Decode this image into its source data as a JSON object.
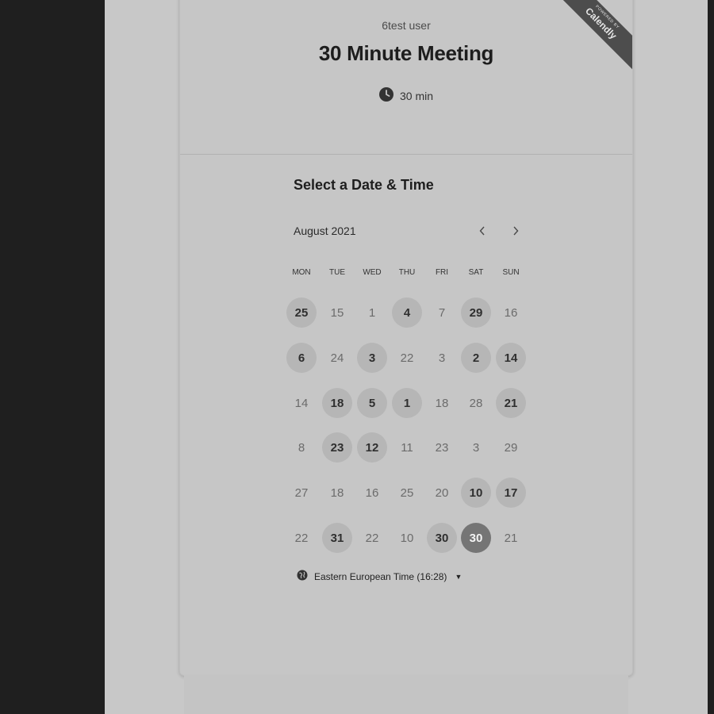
{
  "event": {
    "owner": "6test user",
    "title": "30 Minute Meeting",
    "duration": "30 min"
  },
  "ribbon": {
    "powered_by": "POWERED BY",
    "brand": "Calendly"
  },
  "booking": {
    "section_title": "Select a Date & Time",
    "month": "August 2021"
  },
  "calendar": {
    "weekdays": [
      "MON",
      "TUE",
      "WED",
      "THU",
      "FRI",
      "SAT",
      "SUN"
    ],
    "weeks": [
      [
        {
          "d": "25",
          "s": "avail"
        },
        {
          "d": "15",
          "s": "unavail"
        },
        {
          "d": "1",
          "s": "unavail"
        },
        {
          "d": "4",
          "s": "avail"
        },
        {
          "d": "7",
          "s": "unavail"
        },
        {
          "d": "29",
          "s": "avail"
        },
        {
          "d": "16",
          "s": "unavail"
        }
      ],
      [
        {
          "d": "6",
          "s": "avail"
        },
        {
          "d": "24",
          "s": "unavail"
        },
        {
          "d": "3",
          "s": "avail"
        },
        {
          "d": "22",
          "s": "unavail"
        },
        {
          "d": "3",
          "s": "unavail"
        },
        {
          "d": "2",
          "s": "avail"
        },
        {
          "d": "14",
          "s": "avail"
        }
      ],
      [
        {
          "d": "14",
          "s": "unavail"
        },
        {
          "d": "18",
          "s": "avail"
        },
        {
          "d": "5",
          "s": "avail"
        },
        {
          "d": "1",
          "s": "avail"
        },
        {
          "d": "18",
          "s": "unavail"
        },
        {
          "d": "28",
          "s": "unavail"
        },
        {
          "d": "21",
          "s": "avail"
        }
      ],
      [
        {
          "d": "8",
          "s": "unavail"
        },
        {
          "d": "23",
          "s": "avail"
        },
        {
          "d": "12",
          "s": "avail"
        },
        {
          "d": "11",
          "s": "unavail"
        },
        {
          "d": "23",
          "s": "unavail"
        },
        {
          "d": "3",
          "s": "unavail"
        },
        {
          "d": "29",
          "s": "unavail"
        }
      ],
      [
        {
          "d": "27",
          "s": "unavail"
        },
        {
          "d": "18",
          "s": "unavail"
        },
        {
          "d": "16",
          "s": "unavail"
        },
        {
          "d": "25",
          "s": "unavail"
        },
        {
          "d": "20",
          "s": "unavail"
        },
        {
          "d": "10",
          "s": "avail"
        },
        {
          "d": "17",
          "s": "avail"
        }
      ],
      [
        {
          "d": "22",
          "s": "unavail"
        },
        {
          "d": "31",
          "s": "avail"
        },
        {
          "d": "22",
          "s": "unavail"
        },
        {
          "d": "10",
          "s": "unavail"
        },
        {
          "d": "30",
          "s": "avail"
        },
        {
          "d": "30",
          "s": "selected"
        },
        {
          "d": "21",
          "s": "unavail"
        }
      ]
    ]
  },
  "timezone": {
    "label": "Eastern European Time (16:28)"
  },
  "icons": {
    "duration": "clock-icon",
    "timezone": "globe-icon",
    "prev": "chevron-left-icon",
    "next": "chevron-right-icon",
    "dropdown": "caret-down-icon"
  },
  "colors": {
    "available_bg": "#b6b6b6",
    "selected_bg": "#757575",
    "ribbon_bg": "#4d4d4d"
  }
}
